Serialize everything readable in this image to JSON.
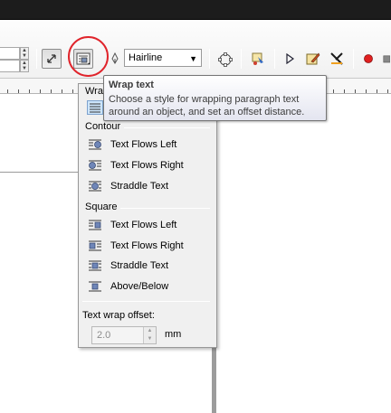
{
  "toolbar": {
    "outline_width": "Hairline"
  },
  "tooltip": {
    "title": "Wrap text",
    "body": "Choose a style for wrapping paragraph text around an object, and set an offset distance."
  },
  "wrap_menu": {
    "header_partial": "Wrap",
    "contour": {
      "header": "Contour",
      "items": [
        {
          "label": "Text Flows Left",
          "icon": "text-flows-left-icon"
        },
        {
          "label": "Text Flows Right",
          "icon": "text-flows-right-icon"
        },
        {
          "label": "Straddle Text",
          "icon": "straddle-text-icon"
        }
      ]
    },
    "square": {
      "header": "Square",
      "items": [
        {
          "label": "Text Flows Left",
          "icon": "text-flows-left-icon"
        },
        {
          "label": "Text Flows Right",
          "icon": "text-flows-right-icon"
        },
        {
          "label": "Straddle Text",
          "icon": "straddle-text-icon"
        },
        {
          "label": "Above/Below",
          "icon": "above-below-icon"
        }
      ]
    },
    "offset": {
      "label": "Text wrap offset:",
      "value": "2.0",
      "unit": "mm"
    }
  }
}
